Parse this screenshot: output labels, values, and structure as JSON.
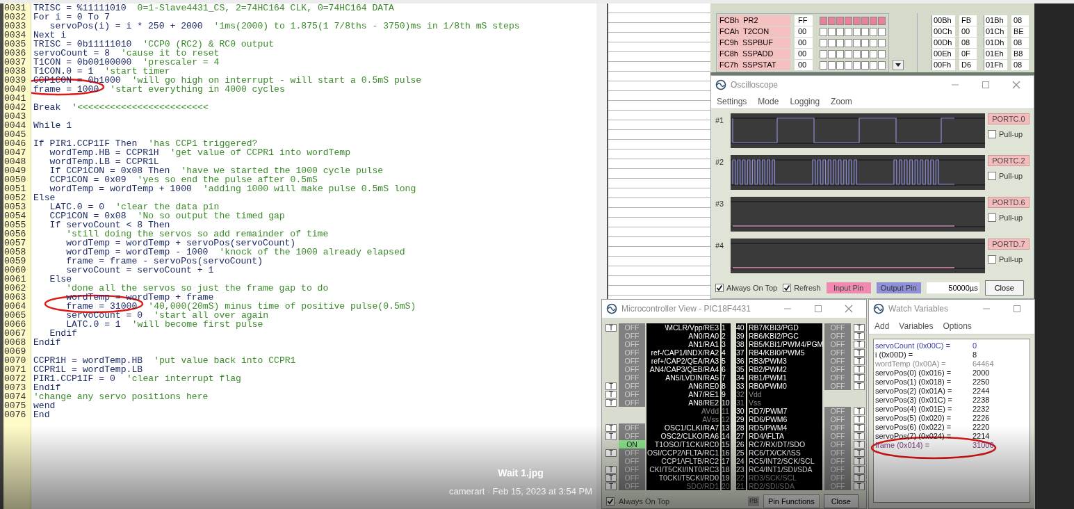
{
  "editor": {
    "lines": [
      {
        "number": "0031",
        "code": "TRISC = %11111010",
        "comment": "0=1-Slave4431_CS, 2=74HC164 CLK, 0=74HC164 DATA"
      },
      {
        "number": "0032",
        "code": "For i = 0 To 7"
      },
      {
        "number": "0033",
        "code": "   servoPos(i) = i * 250 + 2000",
        "comment": "'1ms(2000) to 1.875(1 7/8ths - 3750)ms in 1/8th mS steps"
      },
      {
        "number": "0034",
        "code": "Next i"
      },
      {
        "number": "0035",
        "code": "TRISC = 0b11111010",
        "comment": "'CCP0 (RC2) & RC0 output"
      },
      {
        "number": "0036",
        "code": "servoCount = 8",
        "comment": "'cause it to reset"
      },
      {
        "number": "0037",
        "code": "T1CON = 0b00100000",
        "comment": "'prescaler = 4"
      },
      {
        "number": "0038",
        "code": "T1CON.0 = 1",
        "comment": "'start timer"
      },
      {
        "number": "0039",
        "code": "CCP1CON = 0b1000",
        "comment": "'will go high on interrupt - will start a 0.5mS pulse"
      },
      {
        "number": "0040",
        "code": "frame = 1000",
        "comment": "'start everything in 4000 cycles"
      },
      {
        "number": "0041"
      },
      {
        "number": "0042",
        "code": "Break",
        "comment": "'<<<<<<<<<<<<<<<<<<<<<<<<"
      },
      {
        "number": "0043"
      },
      {
        "number": "0044",
        "code": "While 1"
      },
      {
        "number": "0045"
      },
      {
        "number": "0046",
        "code": "If PIR1.CCP1IF Then",
        "comment": "'has CCP1 triggered?"
      },
      {
        "number": "0047",
        "code": "   wordTemp.HB = CCPR1H",
        "comment": "'get value of CCPR1 into wordTemp"
      },
      {
        "number": "0048",
        "code": "   wordTemp.LB = CCPR1L"
      },
      {
        "number": "0049",
        "code": "   If CCP1CON = 0x08 Then",
        "comment": "'have we started the 1000 cycle pulse"
      },
      {
        "number": "0050",
        "code": "   CCP1CON = 0x09",
        "comment": "'yes so end the pulse after 0.5mS"
      },
      {
        "number": "0051",
        "code": "   wordTemp = wordTemp + 1000",
        "comment": "'adding 1000 will make pulse 0.5mS long"
      },
      {
        "number": "0052",
        "code": "Else"
      },
      {
        "number": "0053",
        "code": "   LATC.0 = 0",
        "comment": "'clear the data pin"
      },
      {
        "number": "0054",
        "code": "   CCP1CON = 0x08",
        "comment": "'No so output the timed gap"
      },
      {
        "number": "0055",
        "code": "   If servoCount < 8 Then"
      },
      {
        "number": "0056",
        "comment": "      'still doing the servos so add remainder of time"
      },
      {
        "number": "0057",
        "code": "      wordTemp = wordTemp + servoPos(servoCount)"
      },
      {
        "number": "0058",
        "code": "      wordTemp = wordTemp - 1000",
        "comment": "'knock of the 1000 already elapsed"
      },
      {
        "number": "0059",
        "code": "      frame = frame - servoPos(servoCount)"
      },
      {
        "number": "0060",
        "code": "      servoCount = servoCount + 1"
      },
      {
        "number": "0061",
        "code": "   Else"
      },
      {
        "number": "0062",
        "comment": "      'done all the servos so just the frame gap to do"
      },
      {
        "number": "0063",
        "code": "      wordTemp = wordTemp + frame"
      },
      {
        "number": "0064",
        "code": "      frame = 31000",
        "comment": "'40,000(20mS) minus time of positive pulse(0.5mS)"
      },
      {
        "number": "0065",
        "code": "      servoCount = 0",
        "comment": "'start all over again"
      },
      {
        "number": "0066",
        "code": "      LATC.0 = 1",
        "comment": "'will become first pulse"
      },
      {
        "number": "0067",
        "code": "   Endif"
      },
      {
        "number": "0068",
        "code": "Endif"
      },
      {
        "number": "0069"
      },
      {
        "number": "0070",
        "code": "CCPR1H = wordTemp.HB",
        "comment": "'put value back into CCPR1"
      },
      {
        "number": "0071",
        "code": "CCPR1L = wordTemp.LB"
      },
      {
        "number": "0072",
        "code": "PIR1.CCP1IF = 0",
        "comment": "'clear interrupt flag"
      },
      {
        "number": "0073",
        "code": "Endif"
      },
      {
        "number": "0074",
        "comment": "'change any servo positions here"
      },
      {
        "number": "0075",
        "code": "wend"
      },
      {
        "number": "0076",
        "code": "End"
      }
    ]
  },
  "registers": {
    "rows": [
      {
        "name": "FCBh  PR2",
        "value": "FF",
        "bits": [
          true,
          true,
          true,
          true,
          true,
          true,
          true,
          true
        ]
      },
      {
        "name": "FCAh  T2CON",
        "value": "00",
        "bits": [
          false,
          false,
          false,
          false,
          false,
          false,
          false,
          false
        ]
      },
      {
        "name": "FC9h  SSPBUF",
        "value": "00",
        "bits": [
          false,
          false,
          false,
          false,
          false,
          false,
          false,
          false
        ]
      },
      {
        "name": "FC8h  SSPADD",
        "value": "00",
        "bits": [
          false,
          false,
          false,
          false,
          false,
          false,
          false,
          false
        ]
      },
      {
        "name": "FC7h  SSPSTAT",
        "value": "00",
        "bits": [
          false,
          false,
          false,
          false,
          false,
          false,
          false,
          false
        ]
      }
    ],
    "memory": [
      {
        "address": "00Bh",
        "value": "FB",
        "address_2": "01Bh",
        "value_2": "08"
      },
      {
        "address": "00Ch",
        "value": "00",
        "address_2": "01Ch",
        "value_2": "BE"
      },
      {
        "address": "00Dh",
        "value": "08",
        "address_2": "01Dh",
        "value_2": "08"
      },
      {
        "address": "00Eh",
        "value": "0F",
        "address_2": "01Eh",
        "value_2": "B8"
      },
      {
        "address": "00Fh",
        "value": "D6",
        "address_2": "01Fh",
        "value_2": "08"
      }
    ]
  },
  "oscilloscope": {
    "title": "Oscilloscope",
    "menu": [
      "Settings",
      "Mode",
      "Logging",
      "Zoom"
    ],
    "channels": [
      {
        "label": "#1",
        "pin": "PORTC.0",
        "pullup_label": "Pull-up",
        "pullup": false
      },
      {
        "label": "#2",
        "pin": "PORTC.2",
        "pullup_label": "Pull-up",
        "pullup": false
      },
      {
        "label": "#3",
        "pin": "PORTD.6",
        "pullup_label": "Pull-up",
        "pullup": false
      },
      {
        "label": "#4",
        "pin": "PORTD.7",
        "pullup_label": "Pull-up",
        "pullup": false
      }
    ],
    "always_on_top": {
      "label": "Always On Top",
      "checked": true
    },
    "refresh": {
      "label": "Refresh",
      "checked": true
    },
    "input_pin": "Input Pin",
    "output_pin": "Output Pin",
    "timebase": "50000µs",
    "close": "Close"
  },
  "microcontroller": {
    "title": "Microcontroller View - PIC18F4431",
    "left_pins": [
      {
        "t": "T",
        "state": "OFF",
        "on": false,
        "name": "\\MCLR/Vpp/RE3",
        "number": "1",
        "dimmed": false
      },
      {
        "state": "OFF",
        "on": false,
        "name": "AN0/RA0",
        "number": "2",
        "dimmed": false
      },
      {
        "state": "OFF",
        "on": false,
        "name": "AN1/RA1",
        "number": "3",
        "dimmed": false
      },
      {
        "state": "OFF",
        "on": false,
        "name": "ref-/CAP1/INDX/RA2",
        "number": "4",
        "dimmed": false
      },
      {
        "state": "OFF",
        "on": false,
        "name": "ref+/CAP2/QEA/RA3",
        "number": "5",
        "dimmed": false
      },
      {
        "state": "OFF",
        "on": false,
        "name": "AN4/CAP3/QEB/RA4",
        "number": "6",
        "dimmed": false
      },
      {
        "state": "OFF",
        "on": false,
        "name": "AN5/LVDIN/RA5",
        "number": "7",
        "dimmed": false
      },
      {
        "t": "T",
        "state": "OFF",
        "on": false,
        "name": "AN6/RE0",
        "number": "8",
        "dimmed": false
      },
      {
        "t": "T",
        "state": "OFF",
        "on": false,
        "name": "AN7/RE1",
        "number": "9",
        "dimmed": false
      },
      {
        "t": "T",
        "state": "OFF",
        "on": false,
        "name": "AN8/RE2",
        "number": "10",
        "dimmed": false
      },
      {
        "name": "AVdd",
        "number": "11",
        "dimmed": true
      },
      {
        "name": "AVss",
        "number": "12",
        "dimmed": true
      },
      {
        "t": "T",
        "state": "OFF",
        "on": false,
        "name": "OSC1/CLKI/RA7",
        "number": "13",
        "dimmed": false
      },
      {
        "t": "T",
        "state": "OFF",
        "on": false,
        "name": "OSC2/CLKO/RA6",
        "number": "14",
        "dimmed": false
      },
      {
        "state": "ON",
        "on": true,
        "name": "T1OSO/T1CKI/RC0",
        "number": "15",
        "dimmed": false
      },
      {
        "t": "T",
        "state": "OFF",
        "on": false,
        "name": "OSI/CCP2/\\FLTA/RC1",
        "number": "16",
        "dimmed": false
      },
      {
        "state": "OFF",
        "on": false,
        "name": "CCP1/\\FLTB/RC2",
        "number": "17",
        "dimmed": false
      },
      {
        "t": "T",
        "state": "OFF",
        "on": false,
        "name": "CKI/T5CKI/INT0/RC3",
        "number": "18",
        "dimmed": false
      },
      {
        "t": "T",
        "state": "OFF",
        "on": false,
        "name": "T0CKI/T5CKI/RD0",
        "number": "19",
        "dimmed": false
      },
      {
        "t": "T",
        "state": "OFF",
        "on": false,
        "name": "SDO/RD1",
        "number": "20",
        "dimmed": true
      }
    ],
    "right_pins": [
      {
        "t": "T",
        "state": "OFF",
        "on": false,
        "name": "RB7/KBI3/PGD",
        "number": "40",
        "dimmed": false
      },
      {
        "t": "T",
        "state": "OFF",
        "on": false,
        "name": "RB6/KBI2/PGC",
        "number": "39",
        "dimmed": false
      },
      {
        "t": "T",
        "state": "OFF",
        "on": false,
        "name": "RB5/KBI1/PWM4/PGM",
        "number": "38",
        "dimmed": false
      },
      {
        "t": "T",
        "state": "OFF",
        "on": false,
        "name": "RB4/KBI0/PWM5",
        "number": "37",
        "dimmed": false
      },
      {
        "t": "T",
        "state": "OFF",
        "on": false,
        "name": "RB3/PWM3",
        "number": "36",
        "dimmed": false
      },
      {
        "t": "T",
        "state": "OFF",
        "on": false,
        "name": "RB2/PWM2",
        "number": "35",
        "dimmed": false
      },
      {
        "t": "T",
        "state": "OFF",
        "on": false,
        "name": "RB1/PWM1",
        "number": "34",
        "dimmed": false
      },
      {
        "t": "T",
        "state": "OFF",
        "on": false,
        "name": "RB0/PWM0",
        "number": "33",
        "dimmed": false
      },
      {
        "name": "Vdd",
        "number": "32",
        "dimmed": true
      },
      {
        "name": "Vss",
        "number": "31",
        "dimmed": true
      },
      {
        "t": "T",
        "state": "OFF",
        "on": false,
        "name": "RD7/PWM7",
        "number": "30",
        "dimmed": false
      },
      {
        "t": "T",
        "state": "OFF",
        "on": false,
        "name": "RD6/PWM6",
        "number": "29",
        "dimmed": false
      },
      {
        "t": "T",
        "state": "OFF",
        "on": false,
        "name": "RD5/PWM4",
        "number": "28",
        "dimmed": false
      },
      {
        "t": "T",
        "state": "OFF",
        "on": false,
        "name": "RD4/\\FLTA",
        "number": "27",
        "dimmed": false
      },
      {
        "t": "T",
        "state": "OFF",
        "on": false,
        "name": "RC7/RX/DT/SDO",
        "number": "26",
        "dimmed": false
      },
      {
        "t": "T",
        "state": "OFF",
        "on": false,
        "name": "RC6/TX/CK/\\SS",
        "number": "25",
        "dimmed": false
      },
      {
        "t": "T",
        "state": "OFF",
        "on": false,
        "name": "RC5/INT2/SCK/SCL",
        "number": "24",
        "dimmed": false
      },
      {
        "t": "T",
        "state": "OFF",
        "on": false,
        "name": "RC4/INT1/SDI/SDA",
        "number": "23",
        "dimmed": false
      },
      {
        "t": "T",
        "state": "OFF",
        "on": false,
        "name": "RD3/SCK/SCL",
        "number": "22",
        "dimmed": true
      },
      {
        "t": "T",
        "state": "OFF",
        "on": false,
        "name": "RD2/SDI/SDA",
        "number": "21",
        "dimmed": true
      }
    ],
    "always_on_top": {
      "label": "Always On Top",
      "checked": true
    },
    "pb": "PB",
    "pin_functions": "Pin Functions",
    "close": "Close"
  },
  "watch": {
    "title": "Watch Variables",
    "menu": [
      "Add",
      "Variables",
      "Options"
    ],
    "variables": [
      {
        "name": "servoCount (0x00C) =",
        "value": "0",
        "color": "#3a3aa8"
      },
      {
        "name": "i (0x00D) =",
        "value": "8",
        "color": "#111111"
      },
      {
        "name": "wordTemp (0x00A) =",
        "value": "64464",
        "color": "#8a8a8a"
      },
      {
        "name": "servoPos(0) (0x016) =",
        "value": "2000",
        "color": "#111111"
      },
      {
        "name": "servoPos(1) (0x018) =",
        "value": "2250",
        "color": "#111111"
      },
      {
        "name": "servoPos(2) (0x01A) =",
        "value": "2244",
        "color": "#111111"
      },
      {
        "name": "servoPos(3) (0x01C) =",
        "value": "2238",
        "color": "#111111"
      },
      {
        "name": "servoPos(4) (0x01E) =",
        "value": "2232",
        "color": "#111111"
      },
      {
        "name": "servoPos(5) (0x020) =",
        "value": "2226",
        "color": "#111111"
      },
      {
        "name": "servoPos(6) (0x022) =",
        "value": "2220",
        "color": "#111111"
      },
      {
        "name": "servoPos(7) (0x024) =",
        "value": "2214",
        "color": "#111111"
      },
      {
        "name": "frame (0x014) =",
        "value": "31000",
        "color": "#7a3a7a"
      }
    ]
  },
  "viewer": {
    "filename": "Wait 1.jpg",
    "caption": "camerart · Feb 15, 2023 at 3:54 PM"
  }
}
